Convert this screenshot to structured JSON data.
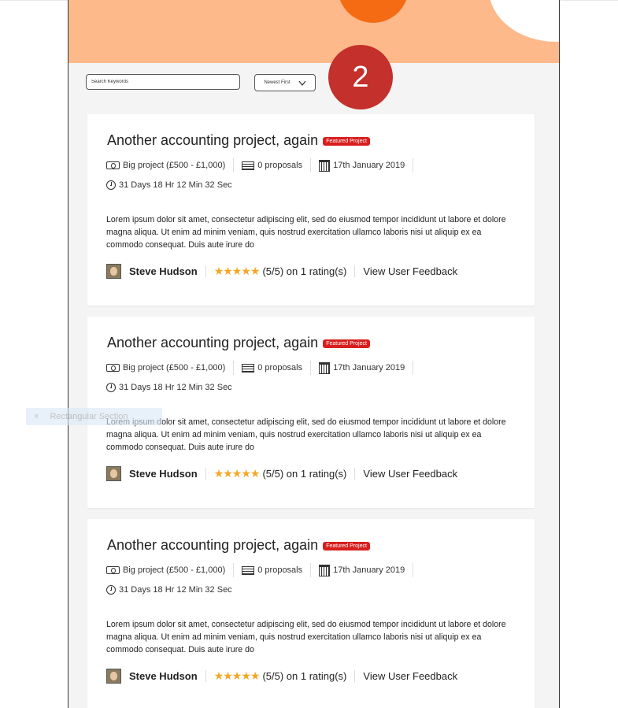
{
  "filters": {
    "search_placeholder": "Search Keywords",
    "sort_label": "Newest First",
    "sort_icon": "chevron-down-icon"
  },
  "step_badge": "2",
  "projects": [
    {
      "title": "Another accounting project, again",
      "featured": "Featured Project",
      "budget": "Big project (£500 - £1,000)",
      "proposals": "0 proposals",
      "date": "17th January 2019",
      "time_left": "31 Days 18 Hr 12 Min 32 Sec",
      "description": "Lorem ipsum dolor sit amet, consectetur adipiscing elit, sed do eiusmod tempor incididunt ut labore et dolore magna aliqua. Ut enim ad minim veniam, quis nostrud exercitation ullamco laboris nisi ut aliquip ex ea commodo consequat. Duis aute irure do",
      "user": "Steve Hudson",
      "stars": "★★★★★",
      "rating": "(5/5) on 1 rating(s)",
      "feedback": "View User Feedback"
    },
    {
      "title": "Another accounting project, again",
      "featured": "Featured Project",
      "budget": "Big project (£500 - £1,000)",
      "proposals": "0 proposals",
      "date": "17th January 2019",
      "time_left": "31 Days 18 Hr 12 Min 32 Sec",
      "description": "Lorem ipsum dolor sit amet, consectetur adipiscing elit, sed do eiusmod tempor incididunt ut labore et dolore magna aliqua. Ut enim ad minim veniam, quis nostrud exercitation ullamco laboris nisi ut aliquip ex ea commodo consequat. Duis aute irure do",
      "user": "Steve Hudson",
      "stars": "★★★★★",
      "rating": "(5/5) on 1 rating(s)",
      "feedback": "View User Feedback"
    },
    {
      "title": "Another accounting project, again",
      "featured": "Featured Project",
      "budget": "Big project (£500 - £1,000)",
      "proposals": "0 proposals",
      "date": "17th January 2019",
      "time_left": "31 Days 18 Hr 12 Min 32 Sec",
      "description": "Lorem ipsum dolor sit amet, consectetur adipiscing elit, sed do eiusmod tempor incididunt ut labore et dolore magna aliqua. Ut enim ad minim veniam, quis nostrud exercitation ullamco laboris nisi ut aliquip ex ea commodo consequat. Duis aute irure do",
      "user": "Steve Hudson",
      "stars": "★★★★★",
      "rating": "(5/5) on 1 rating(s)",
      "feedback": "View User Feedback"
    }
  ],
  "overlay": {
    "ghost_label": "Rectangular Section",
    "ghost_icon": "close-icon"
  },
  "colors": {
    "hero": "#feb98a",
    "accent_orange": "#f56b14",
    "badge_red": "#c4302b",
    "featured_red": "#d81e1e",
    "star": "#f5a623"
  }
}
